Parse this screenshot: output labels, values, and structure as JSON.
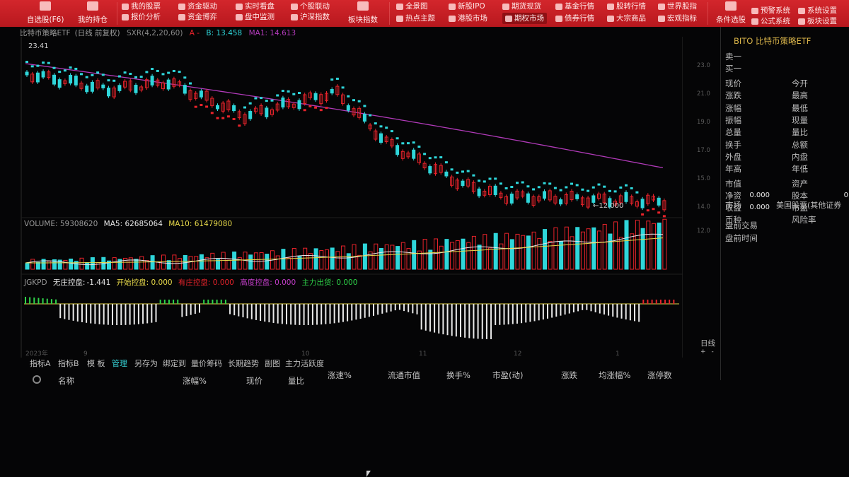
{
  "toolbar": {
    "group1": [
      {
        "label": "自选股(F6)",
        "icon": "star-icon",
        "big": true
      },
      {
        "label": "我的持仓",
        "icon": "briefcase-icon",
        "big": true
      }
    ],
    "group2_top": [
      "我的股票",
      "资金驱动",
      "实时看盘",
      "个股联动"
    ],
    "group2_bottom": [
      "报价分析",
      "资金博弈",
      "盘中监测",
      "沪深指数"
    ],
    "group2_big": {
      "label": "板块指数",
      "icon": "globe-icon"
    },
    "group3_top": [
      "全景图",
      "新股IPO",
      "期货现货",
      "基金行情",
      "股转行情",
      "世界股指"
    ],
    "group3_bottom": [
      "热点主题",
      "港股市场",
      "期权市场",
      "债券行情",
      "大宗商品",
      "宏观指标"
    ],
    "group3_active": "期权市场",
    "group4": {
      "label": "条件选股",
      "icon": "filter-icon"
    },
    "group5_top": [
      "预警系统",
      "系统设置"
    ],
    "group5_bottom": [
      "公式系统",
      "板块设置"
    ]
  },
  "chart": {
    "title_name": "比特币策略ETF",
    "title_period": "(日线 前复权)",
    "indicator": "SXR(4,2,20,60)",
    "ind_a": "A -",
    "ind_b": "B: 13.458",
    "ind_ma1": "MA1: 14.613",
    "top_label": "23.41",
    "low_label": "12.000",
    "volume_hdr": "VOLUME: 59308620",
    "ma5_hdr": "MA5: 62685064",
    "ma10_hdr": "MA10: 61479080",
    "jgkpd_name": "JGKPD",
    "jgkpd_a_label": "无庄控盘:",
    "jgkpd_a_val": "-1.441",
    "jgkpd_b": "开始控盘: 0.000",
    "jgkpd_c": "有庄控盘: 0.000",
    "jgkpd_d": "高度控盘: 0.000",
    "jgkpd_e": "主力出货: 0.000",
    "date_labels": [
      "2023年",
      "9",
      "10",
      "11",
      "12",
      "1"
    ],
    "colors": {
      "up": "#e8232b",
      "down": "#2fd6da",
      "ma": "#b03ab8",
      "yellow": "#e6d84a",
      "white": "#e8e8e8",
      "green": "#2fd64a"
    }
  },
  "info": {
    "title": "BITO 比特币策略ETF",
    "sell1": "卖一",
    "buy1": "买一",
    "left_col": [
      "现价",
      "涨跌",
      "涨幅",
      "振幅",
      "总量",
      "换手",
      "外盘",
      "年高"
    ],
    "right_col": [
      "今开",
      "最高",
      "最低",
      "现量",
      "量比",
      "总额",
      "内盘",
      "年低"
    ],
    "lower_left": [
      "市值",
      "净资",
      "收益",
      "币种",
      "市场"
    ],
    "lower_right": [
      "资产",
      "股本",
      "市盈",
      "风险率"
    ],
    "net_asset_val": "0.000",
    "eps_val": "0.000",
    "equity_val": "0",
    "market_val": "美国股票(其他证券",
    "premarket_trade": "盘前交易",
    "premarket_time": "盘前时间",
    "price_ticks": [
      "23.0",
      "21.0",
      "19.0",
      "17.0",
      "15.0",
      "14.0",
      "12.0"
    ]
  },
  "bottom": {
    "tabs": [
      "指标A",
      "指标B",
      "模 板",
      "管理",
      "另存为",
      "绑定到",
      "量价筹码",
      "长期趋势",
      "副图",
      "主力活跃度"
    ],
    "active_tab": "管理",
    "name_label": "名称",
    "columns": [
      "涨幅%",
      "现价",
      "量比",
      "涨速%",
      "流通市值",
      "换手%",
      "市盈(动)",
      "涨跌",
      "均涨幅%",
      "涨停数"
    ],
    "zoom_label": "日线"
  }
}
